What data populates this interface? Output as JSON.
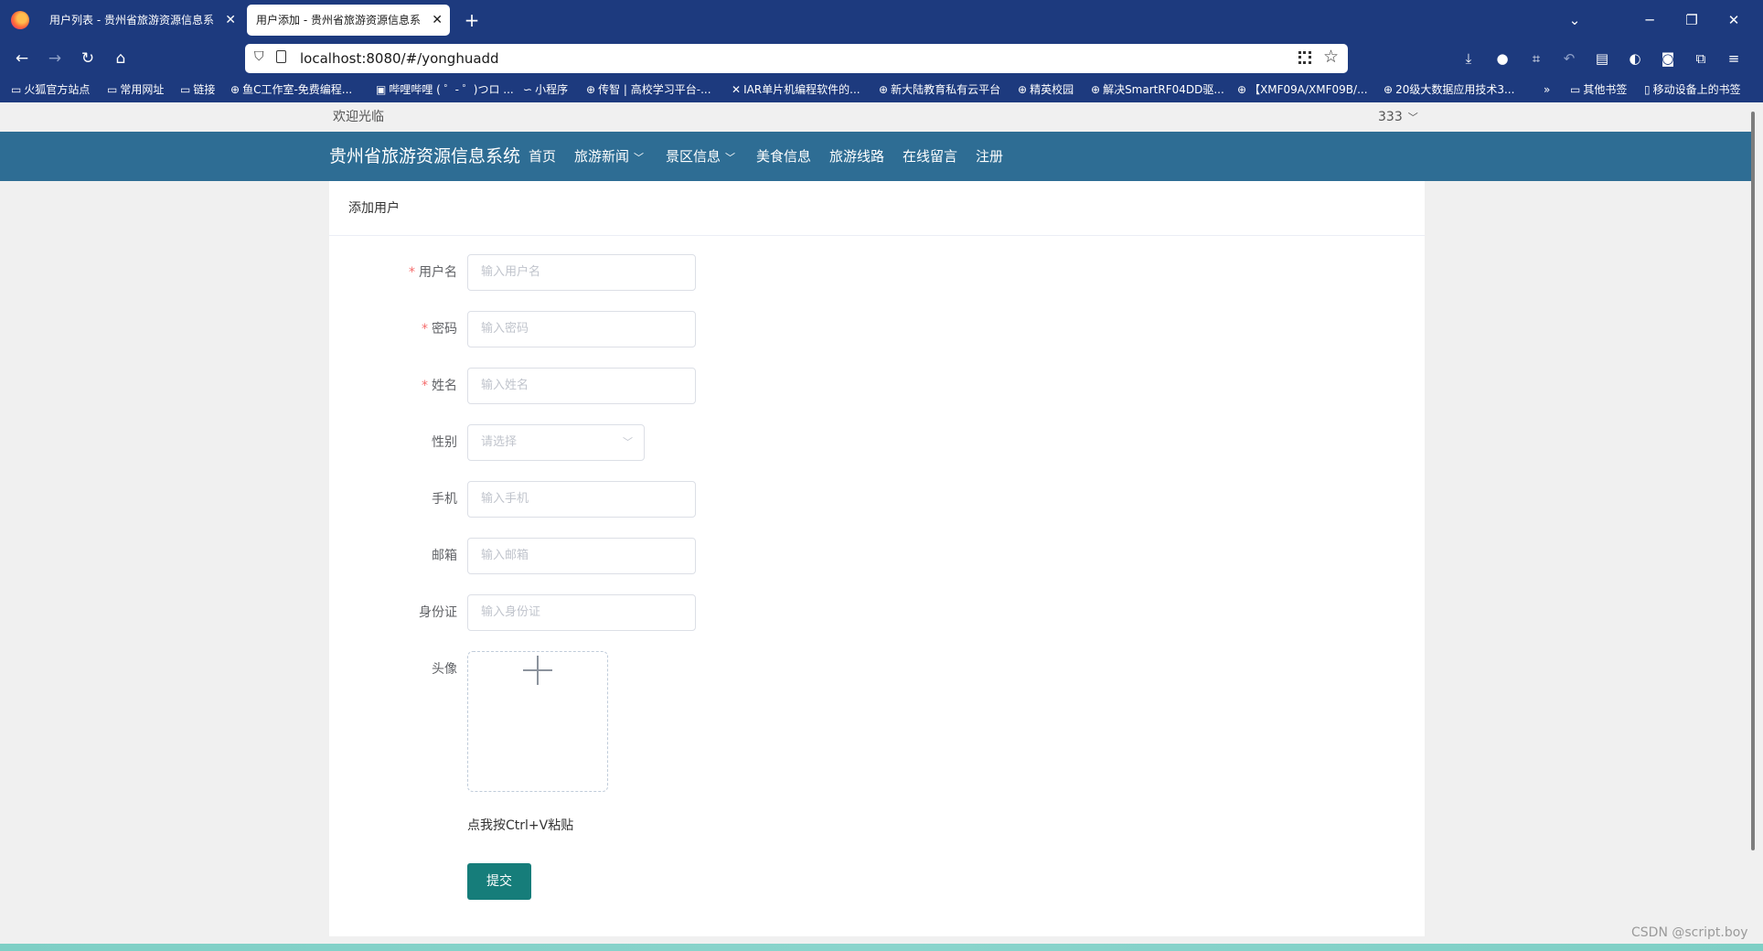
{
  "browser": {
    "tabs": [
      {
        "title": "用户列表 - 贵州省旅游资源信息系统",
        "active": false
      },
      {
        "title": "用户添加 - 贵州省旅游资源信息系统",
        "active": true
      }
    ],
    "url": "localhost:8080/#/yonghuadd",
    "bookmarks": [
      "火狐官方站点",
      "常用网址",
      "链接",
      "鱼C工作室-免费编程...",
      "哔哩哔哩 ( ゜- ゜)つロ ...",
      "小程序",
      "传智 | 高校学习平台-...",
      "IAR单片机编程软件的...",
      "新大陆教育私有云平台",
      "精英校园",
      "解决SmartRF04DD驱...",
      "【XMF09A/XMF09B/...",
      "20级大数据应用技术3...",
      "其他书签",
      "移动设备上的书签"
    ]
  },
  "top": {
    "welcome": "欢迎光临",
    "username": "333"
  },
  "header": {
    "site_title": "贵州省旅游资源信息系统",
    "nav": [
      "首页",
      "旅游新闻",
      "景区信息",
      "美食信息",
      "旅游线路",
      "在线留言",
      "注册"
    ]
  },
  "card": {
    "title": "添加用户"
  },
  "form": {
    "fields": [
      {
        "label": "用户名",
        "placeholder": "输入用户名",
        "required": true
      },
      {
        "label": "密码",
        "placeholder": "输入密码",
        "required": true
      },
      {
        "label": "姓名",
        "placeholder": "输入姓名",
        "required": true
      },
      {
        "label": "性别",
        "placeholder": "请选择",
        "required": false
      },
      {
        "label": "手机",
        "placeholder": "输入手机",
        "required": false
      },
      {
        "label": "邮箱",
        "placeholder": "输入邮箱",
        "required": false
      },
      {
        "label": "身份证",
        "placeholder": "输入身份证",
        "required": false
      }
    ],
    "avatar_label": "头像",
    "paste_hint": "点我按Ctrl+V粘贴",
    "submit_label": "提交",
    "required_mark": "*"
  },
  "watermark": "CSDN @script.boy",
  "colors": {
    "browser_chrome": "#1d3a7e",
    "site_header": "#2e6d94",
    "submit_button": "#167d7a",
    "required_star": "#f56c6c"
  }
}
